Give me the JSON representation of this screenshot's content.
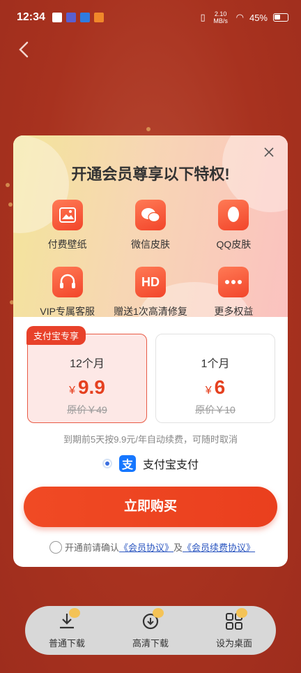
{
  "status_bar": {
    "time": "12:34",
    "net_speed": "2.10 MB/s",
    "battery": "45%"
  },
  "nav": {
    "back_icon": "chevron-left-icon"
  },
  "dialog": {
    "title": "开通会员尊享以下特权!",
    "close_icon": "close-icon",
    "privileges": [
      {
        "label": "付费壁纸",
        "icon": "image-icon"
      },
      {
        "label": "微信皮肤",
        "icon": "wechat-icon"
      },
      {
        "label": "QQ皮肤",
        "icon": "qq-icon"
      },
      {
        "label": "VIP专属客服",
        "icon": "headset-icon"
      },
      {
        "label": "赠送1次高清修复",
        "icon": "hd-icon",
        "icon_text": "HD"
      },
      {
        "label": "更多权益",
        "icon": "more-icon"
      }
    ],
    "plans": [
      {
        "badge": "支付宝专享",
        "name": "12个月",
        "currency": "¥",
        "price": "9.9",
        "original": "原价￥49",
        "selected": true
      },
      {
        "badge": "",
        "name": "1个月",
        "currency": "¥",
        "price": "6",
        "original": "原价￥10",
        "selected": false
      }
    ],
    "renew_note": "到期前5天按9.9元/年自动续费，可随时取消",
    "payment": {
      "label": "支付宝支付",
      "icon": "alipay-icon",
      "icon_text": "支"
    },
    "buy_button": "立即购买",
    "agreement": {
      "prefix": "开通前请确认",
      "link1": "《会员协议》",
      "joiner": "及",
      "link2": "《会员续费协议》"
    }
  },
  "toolbar": [
    {
      "label": "普通下载",
      "icon": "download-icon"
    },
    {
      "label": "高清下载",
      "icon": "hd-download-icon"
    },
    {
      "label": "设为桌面",
      "icon": "set-desktop-icon"
    }
  ],
  "colors": {
    "accent": "#e8412a",
    "background": "#a8321f",
    "alipay": "#1677ff"
  }
}
